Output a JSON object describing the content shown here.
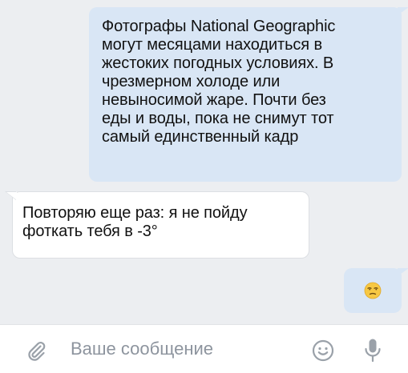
{
  "messages": [
    {
      "direction": "outgoing",
      "text": "Фотографы National Geographic\nмогут месяцами находиться в\nжестоких погодных условиях. В\nчрезмерном холоде или\nневыносимой жаре. Почти без\nеды и воды, пока не снимут тот\nсамый единственный кадр"
    },
    {
      "direction": "incoming",
      "text": "Повторяю еще раз: я не пойду\nфоткать тебя в -3°"
    },
    {
      "direction": "outgoing",
      "emoji": "unamused-face-emoji"
    }
  ],
  "composer": {
    "placeholder": "Ваше сообщение",
    "value": "",
    "attach_icon": "paperclip-icon",
    "emoji_icon": "smiley-icon",
    "mic_icon": "microphone-icon"
  },
  "colors": {
    "chat_background": "#eceef1",
    "outgoing_bubble": "#d9e6f5",
    "incoming_bubble": "#ffffff",
    "icon_gray": "#9aa1a9",
    "placeholder": "#8d949e"
  }
}
